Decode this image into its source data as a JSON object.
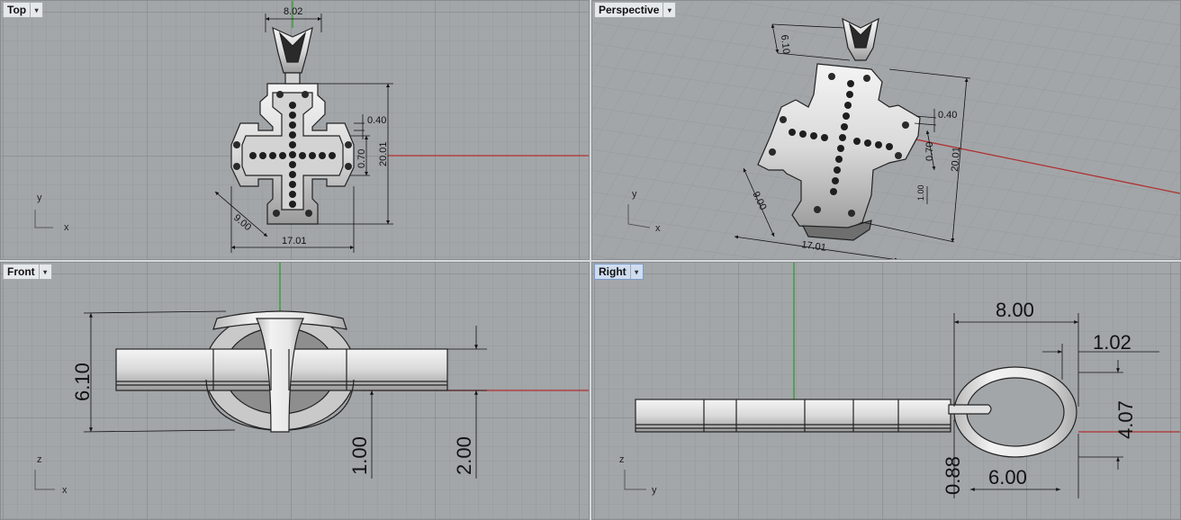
{
  "viewports": {
    "top": {
      "label": "Top",
      "dims": {
        "width_top": "8.02",
        "gap": "0.40",
        "inner": "0.70",
        "height": "20.01",
        "diag": "9.00",
        "width": "17.01"
      },
      "axes": {
        "v": "y",
        "h": "x"
      }
    },
    "perspective": {
      "label": "Perspective",
      "dims": {
        "bail": "6.10",
        "gap": "0.40",
        "inner": "0.70",
        "height": "20.01",
        "small": "1.00",
        "diag": "9.00",
        "width": "17.01"
      },
      "axes": {
        "v": "y",
        "h": "x"
      }
    },
    "front": {
      "label": "Front",
      "dims": {
        "height": "6.10",
        "thick1": "1.00",
        "thick2": "2.00"
      },
      "axes": {
        "v": "z",
        "h": "x"
      }
    },
    "right": {
      "label": "Right",
      "dims": {
        "bail_w": "8.00",
        "ring_t": "1.02",
        "ring_h": "4.07",
        "wire": "0.88",
        "ring_w": "6.00"
      },
      "axes": {
        "v": "z",
        "h": "y"
      }
    }
  },
  "menu_arrow": "▾",
  "colors": {
    "background": "#a3a6a9",
    "grid_minor": "#96999c",
    "grid_major": "#7f8285",
    "x_axis": "#b03030",
    "z_axis": "#2e9c2e",
    "label_bg": "#e6e9ec",
    "active_label_bg": "#cfdcf0"
  }
}
